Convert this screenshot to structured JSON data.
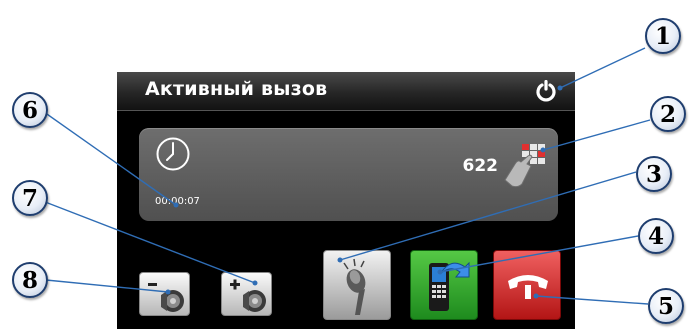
{
  "screen": {
    "title": "Активный вызов",
    "call_timer": "00:00:07",
    "caller_number": "622"
  },
  "icons": {
    "power": "power-icon",
    "clock": "clock-icon",
    "dialpad": "dialpad-icon",
    "volume_down": "speaker-minus-icon",
    "volume_up": "speaker-plus-icon",
    "microphone": "microphone-icon",
    "transfer": "phone-transfer-icon",
    "hangup": "hangup-icon"
  },
  "callouts": [
    "1",
    "2",
    "3",
    "4",
    "5",
    "6",
    "7",
    "8"
  ],
  "colors": {
    "callout_border": "#1e3d6e",
    "leader_line": "#2f6db5",
    "transfer_green": "#2a9a26",
    "hangup_red": "#c62020"
  }
}
